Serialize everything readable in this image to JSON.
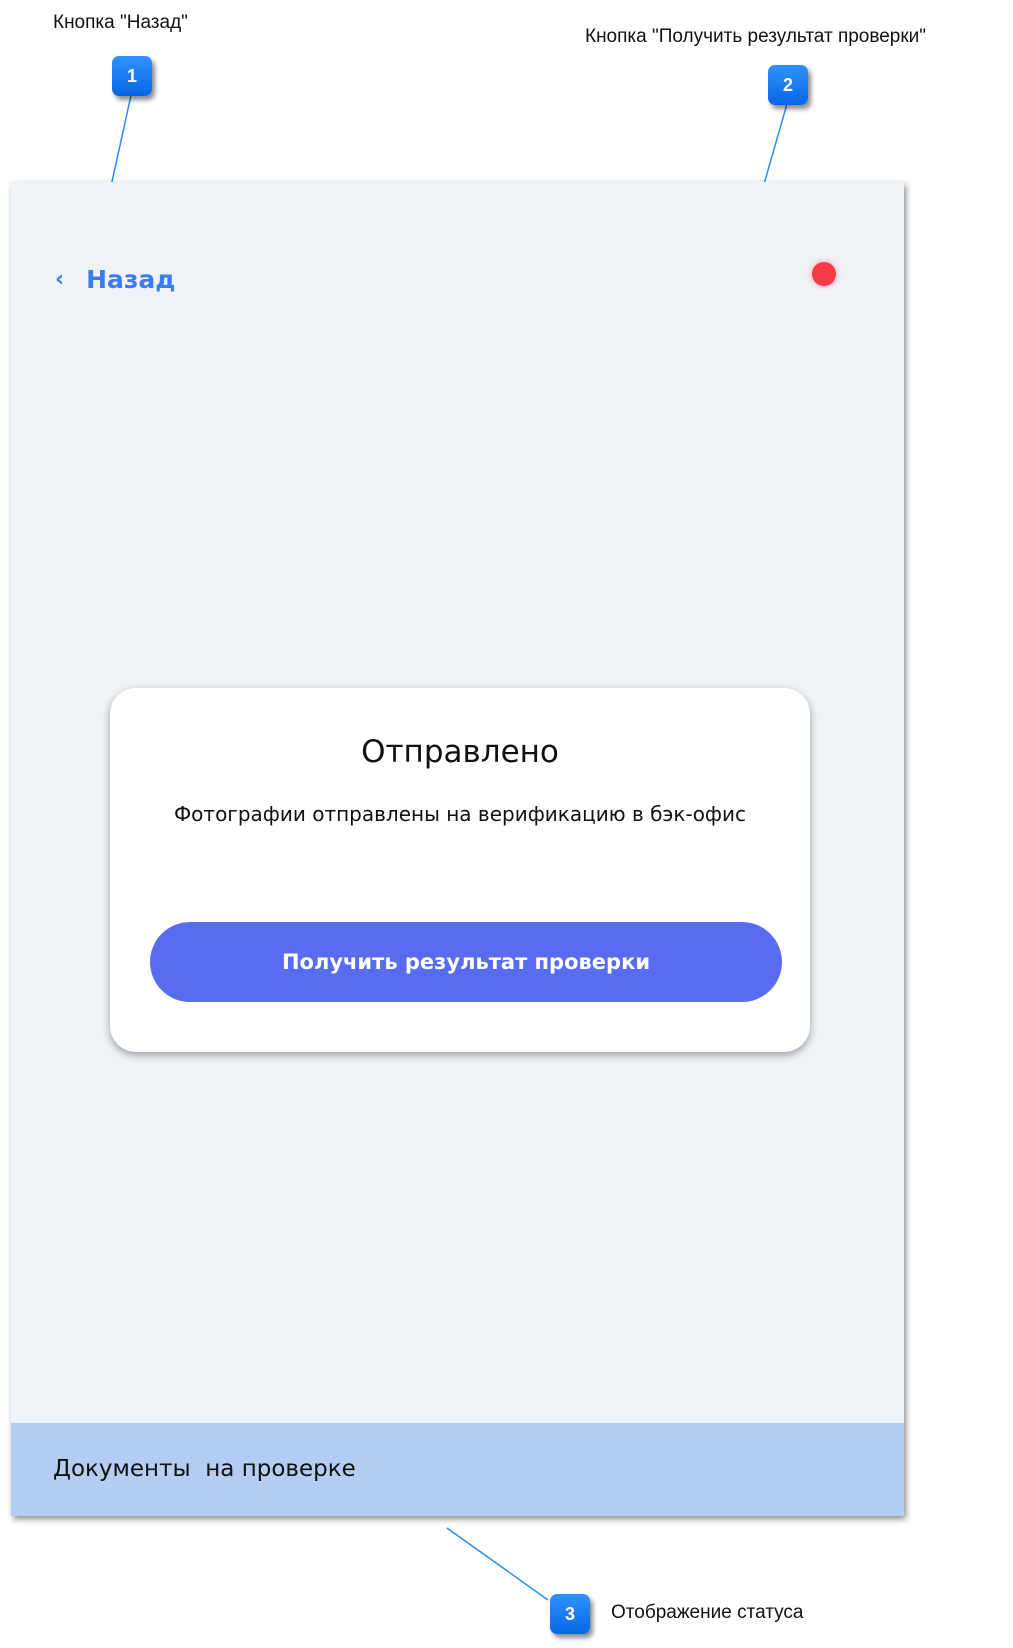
{
  "annotations": [
    {
      "number": "1",
      "label": "Кнопка \"Назад\""
    },
    {
      "number": "2",
      "label": "Кнопка \"Получить результат проверки\""
    },
    {
      "number": "3",
      "label": "Отображение статуса"
    }
  ],
  "screen": {
    "back_chevron": "‹",
    "back_label": "Назад",
    "status_indicator_color": "#f53b47",
    "card": {
      "title": "Отправлено",
      "message": "Фотографии отправлены на верификацию в бэк-офис",
      "button_label": "Получить результат проверки",
      "button_color": "#586cf2"
    },
    "status_text": "Документы  на проверке",
    "status_bar_color": "#b4cdf3",
    "background_color": "#eff2f7",
    "accent_color": "#3d7bf0"
  }
}
